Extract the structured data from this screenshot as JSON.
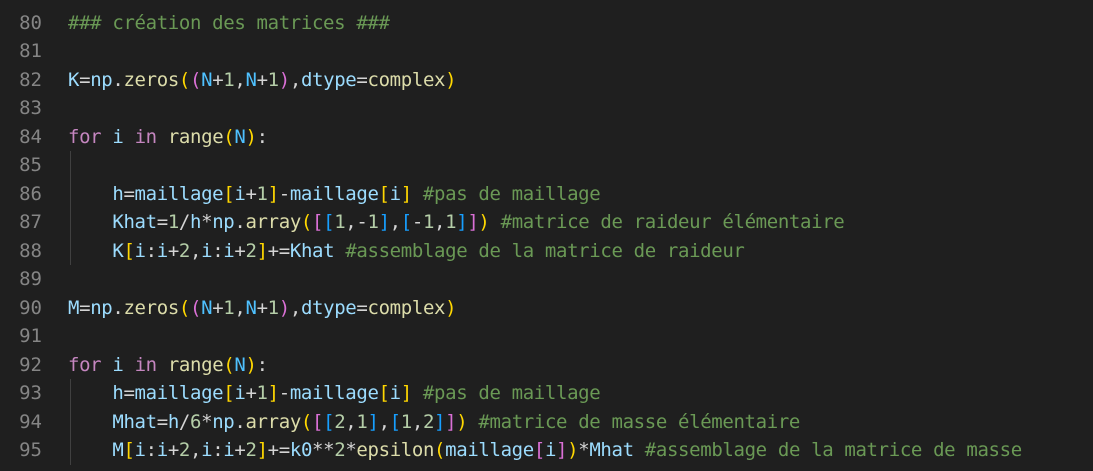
{
  "editor": {
    "lines": [
      {
        "n": "80",
        "tokens": [
          {
            "t": "### création des matrices ###",
            "c": "cm"
          }
        ]
      },
      {
        "n": "81",
        "tokens": []
      },
      {
        "n": "82",
        "tokens": [
          {
            "t": "K",
            "c": "id"
          },
          {
            "t": "=",
            "c": "op"
          },
          {
            "t": "np",
            "c": "id"
          },
          {
            "t": ".",
            "c": "op"
          },
          {
            "t": "zeros",
            "c": "fn"
          },
          {
            "t": "(",
            "c": "b1"
          },
          {
            "t": "(",
            "c": "b2"
          },
          {
            "t": "N",
            "c": "cn"
          },
          {
            "t": "+",
            "c": "op"
          },
          {
            "t": "1",
            "c": "num"
          },
          {
            "t": ",",
            "c": "op"
          },
          {
            "t": "N",
            "c": "cn"
          },
          {
            "t": "+",
            "c": "op"
          },
          {
            "t": "1",
            "c": "num"
          },
          {
            "t": ")",
            "c": "b2"
          },
          {
            "t": ",",
            "c": "op"
          },
          {
            "t": "dtype",
            "c": "id"
          },
          {
            "t": "=",
            "c": "op"
          },
          {
            "t": "complex",
            "c": "fn"
          },
          {
            "t": ")",
            "c": "b1"
          }
        ]
      },
      {
        "n": "83",
        "tokens": []
      },
      {
        "n": "84",
        "tokens": [
          {
            "t": "for",
            "c": "kw"
          },
          {
            "t": " ",
            "c": "op"
          },
          {
            "t": "i",
            "c": "id"
          },
          {
            "t": " ",
            "c": "op"
          },
          {
            "t": "in",
            "c": "kw"
          },
          {
            "t": " ",
            "c": "op"
          },
          {
            "t": "range",
            "c": "fn"
          },
          {
            "t": "(",
            "c": "b1"
          },
          {
            "t": "N",
            "c": "cn"
          },
          {
            "t": ")",
            "c": "b1"
          },
          {
            "t": ":",
            "c": "op"
          }
        ]
      },
      {
        "n": "85",
        "tokens": []
      },
      {
        "n": "86",
        "tokens": [
          {
            "t": "    ",
            "c": "op"
          },
          {
            "t": "h",
            "c": "id"
          },
          {
            "t": "=",
            "c": "op"
          },
          {
            "t": "maillage",
            "c": "id"
          },
          {
            "t": "[",
            "c": "b1"
          },
          {
            "t": "i",
            "c": "id"
          },
          {
            "t": "+",
            "c": "op"
          },
          {
            "t": "1",
            "c": "num"
          },
          {
            "t": "]",
            "c": "b1"
          },
          {
            "t": "-",
            "c": "op"
          },
          {
            "t": "maillage",
            "c": "id"
          },
          {
            "t": "[",
            "c": "b1"
          },
          {
            "t": "i",
            "c": "id"
          },
          {
            "t": "]",
            "c": "b1"
          },
          {
            "t": " ",
            "c": "op"
          },
          {
            "t": "#pas de maillage",
            "c": "cm"
          }
        ]
      },
      {
        "n": "87",
        "tokens": [
          {
            "t": "    ",
            "c": "op"
          },
          {
            "t": "Khat",
            "c": "id"
          },
          {
            "t": "=",
            "c": "op"
          },
          {
            "t": "1",
            "c": "num"
          },
          {
            "t": "/",
            "c": "op"
          },
          {
            "t": "h",
            "c": "id"
          },
          {
            "t": "*",
            "c": "op"
          },
          {
            "t": "np",
            "c": "id"
          },
          {
            "t": ".",
            "c": "op"
          },
          {
            "t": "array",
            "c": "fn"
          },
          {
            "t": "(",
            "c": "b1"
          },
          {
            "t": "[",
            "c": "b2"
          },
          {
            "t": "[",
            "c": "b3"
          },
          {
            "t": "1",
            "c": "num"
          },
          {
            "t": ",",
            "c": "op"
          },
          {
            "t": "-",
            "c": "op"
          },
          {
            "t": "1",
            "c": "num"
          },
          {
            "t": "]",
            "c": "b3"
          },
          {
            "t": ",",
            "c": "op"
          },
          {
            "t": "[",
            "c": "b3"
          },
          {
            "t": "-",
            "c": "op"
          },
          {
            "t": "1",
            "c": "num"
          },
          {
            "t": ",",
            "c": "op"
          },
          {
            "t": "1",
            "c": "num"
          },
          {
            "t": "]",
            "c": "b3"
          },
          {
            "t": "]",
            "c": "b2"
          },
          {
            "t": ")",
            "c": "b1"
          },
          {
            "t": " ",
            "c": "op"
          },
          {
            "t": "#matrice de raideur élémentaire",
            "c": "cm"
          }
        ]
      },
      {
        "n": "88",
        "tokens": [
          {
            "t": "    ",
            "c": "op"
          },
          {
            "t": "K",
            "c": "id"
          },
          {
            "t": "[",
            "c": "b1"
          },
          {
            "t": "i",
            "c": "id"
          },
          {
            "t": ":",
            "c": "op"
          },
          {
            "t": "i",
            "c": "id"
          },
          {
            "t": "+",
            "c": "op"
          },
          {
            "t": "2",
            "c": "num"
          },
          {
            "t": ",",
            "c": "op"
          },
          {
            "t": "i",
            "c": "id"
          },
          {
            "t": ":",
            "c": "op"
          },
          {
            "t": "i",
            "c": "id"
          },
          {
            "t": "+",
            "c": "op"
          },
          {
            "t": "2",
            "c": "num"
          },
          {
            "t": "]",
            "c": "b1"
          },
          {
            "t": "+=",
            "c": "op"
          },
          {
            "t": "Khat",
            "c": "id"
          },
          {
            "t": " ",
            "c": "op"
          },
          {
            "t": "#assemblage de la matrice de raideur",
            "c": "cm"
          }
        ]
      },
      {
        "n": "89",
        "tokens": []
      },
      {
        "n": "90",
        "tokens": [
          {
            "t": "M",
            "c": "id"
          },
          {
            "t": "=",
            "c": "op"
          },
          {
            "t": "np",
            "c": "id"
          },
          {
            "t": ".",
            "c": "op"
          },
          {
            "t": "zeros",
            "c": "fn"
          },
          {
            "t": "(",
            "c": "b1"
          },
          {
            "t": "(",
            "c": "b2"
          },
          {
            "t": "N",
            "c": "cn"
          },
          {
            "t": "+",
            "c": "op"
          },
          {
            "t": "1",
            "c": "num"
          },
          {
            "t": ",",
            "c": "op"
          },
          {
            "t": "N",
            "c": "cn"
          },
          {
            "t": "+",
            "c": "op"
          },
          {
            "t": "1",
            "c": "num"
          },
          {
            "t": ")",
            "c": "b2"
          },
          {
            "t": ",",
            "c": "op"
          },
          {
            "t": "dtype",
            "c": "id"
          },
          {
            "t": "=",
            "c": "op"
          },
          {
            "t": "complex",
            "c": "fn"
          },
          {
            "t": ")",
            "c": "b1"
          }
        ]
      },
      {
        "n": "91",
        "tokens": []
      },
      {
        "n": "92",
        "tokens": [
          {
            "t": "for",
            "c": "kw"
          },
          {
            "t": " ",
            "c": "op"
          },
          {
            "t": "i",
            "c": "id"
          },
          {
            "t": " ",
            "c": "op"
          },
          {
            "t": "in",
            "c": "kw"
          },
          {
            "t": " ",
            "c": "op"
          },
          {
            "t": "range",
            "c": "fn"
          },
          {
            "t": "(",
            "c": "b1"
          },
          {
            "t": "N",
            "c": "cn"
          },
          {
            "t": ")",
            "c": "b1"
          },
          {
            "t": ":",
            "c": "op"
          }
        ]
      },
      {
        "n": "93",
        "tokens": [
          {
            "t": "    ",
            "c": "op"
          },
          {
            "t": "h",
            "c": "id"
          },
          {
            "t": "=",
            "c": "op"
          },
          {
            "t": "maillage",
            "c": "id"
          },
          {
            "t": "[",
            "c": "b1"
          },
          {
            "t": "i",
            "c": "id"
          },
          {
            "t": "+",
            "c": "op"
          },
          {
            "t": "1",
            "c": "num"
          },
          {
            "t": "]",
            "c": "b1"
          },
          {
            "t": "-",
            "c": "op"
          },
          {
            "t": "maillage",
            "c": "id"
          },
          {
            "t": "[",
            "c": "b1"
          },
          {
            "t": "i",
            "c": "id"
          },
          {
            "t": "]",
            "c": "b1"
          },
          {
            "t": " ",
            "c": "op"
          },
          {
            "t": "#pas de maillage",
            "c": "cm"
          }
        ]
      },
      {
        "n": "94",
        "tokens": [
          {
            "t": "    ",
            "c": "op"
          },
          {
            "t": "Mhat",
            "c": "id"
          },
          {
            "t": "=",
            "c": "op"
          },
          {
            "t": "h",
            "c": "id"
          },
          {
            "t": "/",
            "c": "op"
          },
          {
            "t": "6",
            "c": "num"
          },
          {
            "t": "*",
            "c": "op"
          },
          {
            "t": "np",
            "c": "id"
          },
          {
            "t": ".",
            "c": "op"
          },
          {
            "t": "array",
            "c": "fn"
          },
          {
            "t": "(",
            "c": "b1"
          },
          {
            "t": "[",
            "c": "b2"
          },
          {
            "t": "[",
            "c": "b3"
          },
          {
            "t": "2",
            "c": "num"
          },
          {
            "t": ",",
            "c": "op"
          },
          {
            "t": "1",
            "c": "num"
          },
          {
            "t": "]",
            "c": "b3"
          },
          {
            "t": ",",
            "c": "op"
          },
          {
            "t": "[",
            "c": "b3"
          },
          {
            "t": "1",
            "c": "num"
          },
          {
            "t": ",",
            "c": "op"
          },
          {
            "t": "2",
            "c": "num"
          },
          {
            "t": "]",
            "c": "b3"
          },
          {
            "t": "]",
            "c": "b2"
          },
          {
            "t": ")",
            "c": "b1"
          },
          {
            "t": " ",
            "c": "op"
          },
          {
            "t": "#matrice de masse élémentaire",
            "c": "cm"
          }
        ]
      },
      {
        "n": "95",
        "tokens": [
          {
            "t": "    ",
            "c": "op"
          },
          {
            "t": "M",
            "c": "id"
          },
          {
            "t": "[",
            "c": "b1"
          },
          {
            "t": "i",
            "c": "id"
          },
          {
            "t": ":",
            "c": "op"
          },
          {
            "t": "i",
            "c": "id"
          },
          {
            "t": "+",
            "c": "op"
          },
          {
            "t": "2",
            "c": "num"
          },
          {
            "t": ",",
            "c": "op"
          },
          {
            "t": "i",
            "c": "id"
          },
          {
            "t": ":",
            "c": "op"
          },
          {
            "t": "i",
            "c": "id"
          },
          {
            "t": "+",
            "c": "op"
          },
          {
            "t": "2",
            "c": "num"
          },
          {
            "t": "]",
            "c": "b1"
          },
          {
            "t": "+=",
            "c": "op"
          },
          {
            "t": "k0",
            "c": "id"
          },
          {
            "t": "**",
            "c": "op"
          },
          {
            "t": "2",
            "c": "num"
          },
          {
            "t": "*",
            "c": "op"
          },
          {
            "t": "epsilon",
            "c": "fn"
          },
          {
            "t": "(",
            "c": "b1"
          },
          {
            "t": "maillage",
            "c": "id"
          },
          {
            "t": "[",
            "c": "b2"
          },
          {
            "t": "i",
            "c": "id"
          },
          {
            "t": "]",
            "c": "b2"
          },
          {
            "t": ")",
            "c": "b1"
          },
          {
            "t": "*",
            "c": "op"
          },
          {
            "t": "Mhat",
            "c": "id"
          },
          {
            "t": " ",
            "c": "op"
          },
          {
            "t": "#assemblage de la matrice de masse",
            "c": "cm"
          }
        ]
      }
    ]
  },
  "colors": {
    "background": "#1f1f1f",
    "line_number": "#858585",
    "comment": "#6a9955",
    "keyword": "#c586c0",
    "function": "#dcdcaa",
    "variable": "#9cdcfe",
    "number": "#b5cea8",
    "bracket_level1": "#ffd700",
    "bracket_level2": "#da70d6",
    "bracket_level3": "#179fff"
  }
}
